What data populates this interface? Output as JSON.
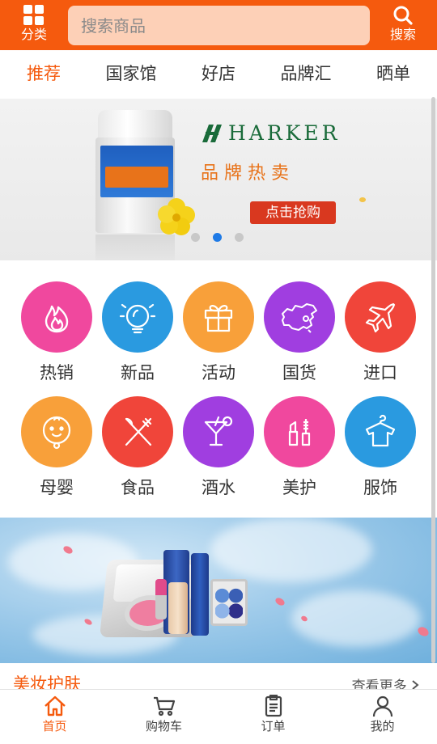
{
  "header": {
    "category_label": "分类",
    "search_placeholder": "搜索商品",
    "search_label": "搜索"
  },
  "tabs": [
    {
      "label": "推荐",
      "active": true
    },
    {
      "label": "国家馆"
    },
    {
      "label": "好店"
    },
    {
      "label": "品牌汇"
    },
    {
      "label": "晒单"
    }
  ],
  "banner": {
    "brand": "HARKER",
    "tagline": "品牌热卖",
    "cta": "点击抢购",
    "slide_count": 3,
    "active_slide": 1
  },
  "categories": [
    {
      "label": "热销",
      "icon": "fire-icon",
      "color": "#f0489e"
    },
    {
      "label": "新品",
      "icon": "lightbulb-icon",
      "color": "#2a9ae0"
    },
    {
      "label": "活动",
      "icon": "gift-icon",
      "color": "#f8a03a"
    },
    {
      "label": "国货",
      "icon": "china-map-icon",
      "color": "#a03ee0"
    },
    {
      "label": "进口",
      "icon": "airplane-icon",
      "color": "#f0453a"
    },
    {
      "label": "母婴",
      "icon": "baby-icon",
      "color": "#f8a03a"
    },
    {
      "label": "食品",
      "icon": "fork-knife-icon",
      "color": "#f0453a"
    },
    {
      "label": "酒水",
      "icon": "cocktail-icon",
      "color": "#a03ee0"
    },
    {
      "label": "美护",
      "icon": "cosmetics-icon",
      "color": "#f0489e"
    },
    {
      "label": "服饰",
      "icon": "shirt-icon",
      "color": "#2a9ae0"
    }
  ],
  "section": {
    "title": "美妆护肤",
    "more": "查看更多"
  },
  "bottom_nav": [
    {
      "label": "首页",
      "icon": "home-icon",
      "active": true
    },
    {
      "label": "购物车",
      "icon": "cart-icon"
    },
    {
      "label": "订单",
      "icon": "order-icon"
    },
    {
      "label": "我的",
      "icon": "user-icon"
    }
  ],
  "colors": {
    "accent": "#f55a0e",
    "search_bg": "#fdd0b7",
    "dot_active": "#1e7ae6"
  }
}
